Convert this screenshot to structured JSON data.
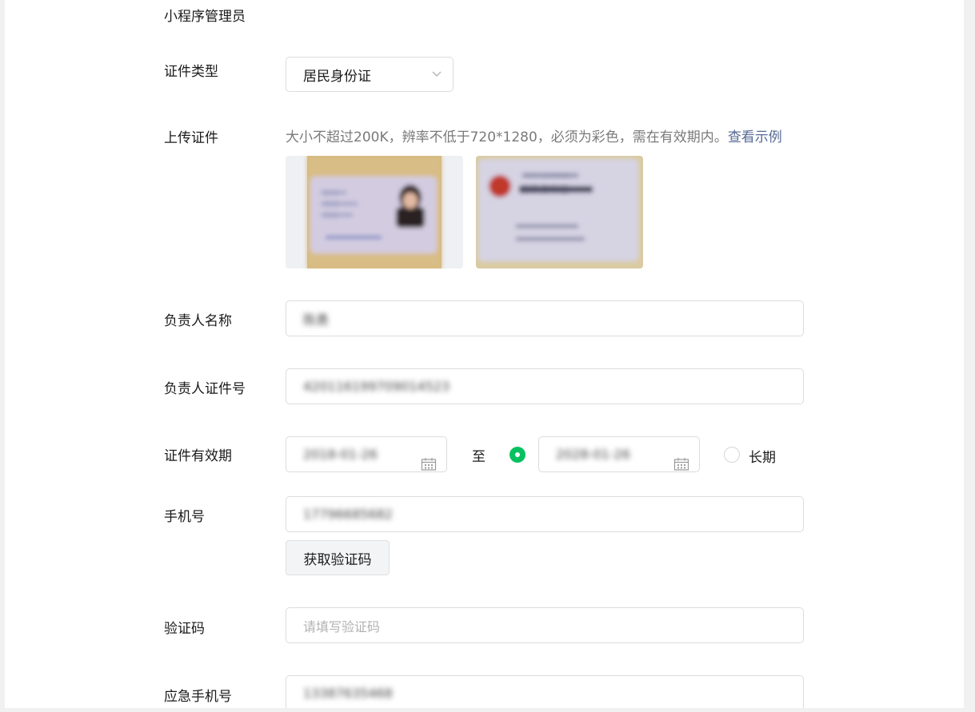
{
  "section_title": "小程序管理员",
  "labels": {
    "id_type": "证件类型",
    "upload": "上传证件",
    "name": "负责人名称",
    "id_number": "负责人证件号",
    "validity": "证件有效期",
    "phone": "手机号",
    "code": "验证码",
    "emergency_phone": "应急手机号"
  },
  "id_type": {
    "selected": "居民身份证",
    "icon": "chevron-down-icon"
  },
  "upload": {
    "hint": "大小不超过200K，辨率不低于720*1280，必须为彩色，需在有效期内。",
    "example_link": "查看示例",
    "front_card_text": [
      "姓名",
      "性别",
      "出生"
    ],
    "back_card_text": [
      "中华人民共和国",
      "居民身份证"
    ]
  },
  "fields": {
    "name_value": "陈勇",
    "id_number_value": "420116199709014523",
    "validity_start": "2018-01-26",
    "validity_to": "至",
    "validity_end": "2028-01-26",
    "long_term": "长期",
    "phone_value": "17796685682",
    "get_code_button": "获取验证码",
    "code_placeholder": "请填写验证码",
    "emergency_phone_value": "13387635468"
  },
  "colors": {
    "accent_green": "#07c160",
    "link": "#576b95"
  }
}
